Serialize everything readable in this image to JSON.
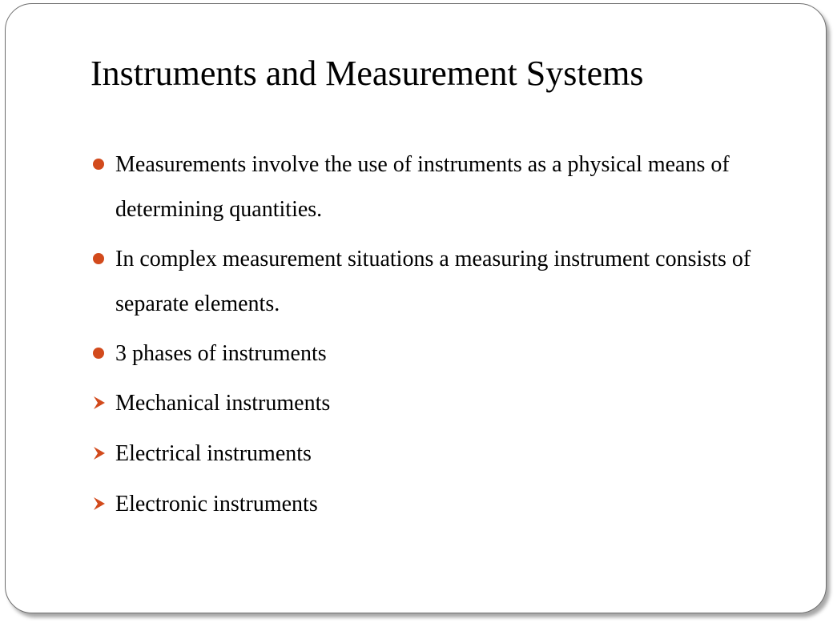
{
  "slide": {
    "title": "Instruments and Measurement Systems",
    "accent_color": "#d24a1c",
    "bullets": [
      {
        "marker": "dot",
        "text": "Measurements involve the use of instruments as a physical means of determining quantities."
      },
      {
        "marker": "dot",
        "text": "In complex measurement situations a measuring instrument consists of separate elements."
      },
      {
        "marker": "dot",
        "text": "3 phases of instruments"
      },
      {
        "marker": "arrow",
        "text": "Mechanical instruments"
      },
      {
        "marker": "arrow",
        "text": "Electrical instruments"
      },
      {
        "marker": "arrow",
        "text": "Electronic instruments"
      }
    ]
  }
}
